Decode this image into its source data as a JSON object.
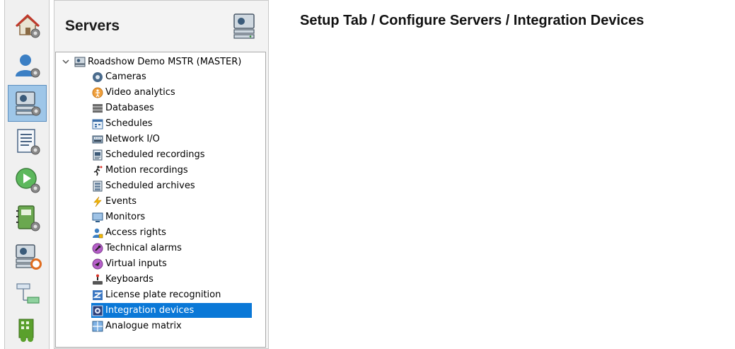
{
  "heading": "Setup Tab / Configure Servers / Integration Devices",
  "sidebar": {
    "items": [
      {
        "name": "home-settings-icon"
      },
      {
        "name": "user-settings-icon"
      },
      {
        "name": "server-settings-icon",
        "active": true
      },
      {
        "name": "list-settings-icon"
      },
      {
        "name": "playback-settings-icon"
      },
      {
        "name": "notebook-settings-icon"
      },
      {
        "name": "server-alarm-icon"
      },
      {
        "name": "network-diagram-icon"
      },
      {
        "name": "building-icon"
      }
    ]
  },
  "panel": {
    "title": "Servers"
  },
  "tree": {
    "root": "Roadshow Demo MSTR (MASTER)",
    "items": [
      {
        "label": "Cameras",
        "icon": "camera-icon"
      },
      {
        "label": "Video analytics",
        "icon": "video-analytics-icon"
      },
      {
        "label": "Databases",
        "icon": "database-icon"
      },
      {
        "label": "Schedules",
        "icon": "calendar-icon"
      },
      {
        "label": "Network I/O",
        "icon": "network-io-icon"
      },
      {
        "label": "Scheduled recordings",
        "icon": "scheduled-recording-icon"
      },
      {
        "label": "Motion recordings",
        "icon": "motion-icon"
      },
      {
        "label": "Scheduled archives",
        "icon": "archive-icon"
      },
      {
        "label": "Events",
        "icon": "lightning-icon"
      },
      {
        "label": "Monitors",
        "icon": "monitor-icon"
      },
      {
        "label": "Access rights",
        "icon": "access-rights-icon"
      },
      {
        "label": "Technical alarms",
        "icon": "wrench-icon"
      },
      {
        "label": "Virtual inputs",
        "icon": "pointer-icon"
      },
      {
        "label": "Keyboards",
        "icon": "keyboard-icon"
      },
      {
        "label": "License plate recognition",
        "icon": "license-plate-icon"
      },
      {
        "label": "Integration devices",
        "icon": "integration-icon",
        "selected": true
      },
      {
        "label": "Analogue matrix",
        "icon": "matrix-icon"
      }
    ]
  },
  "colors": {
    "selection": "#0a78d7",
    "active_sidebar": "#9ec6e8"
  }
}
